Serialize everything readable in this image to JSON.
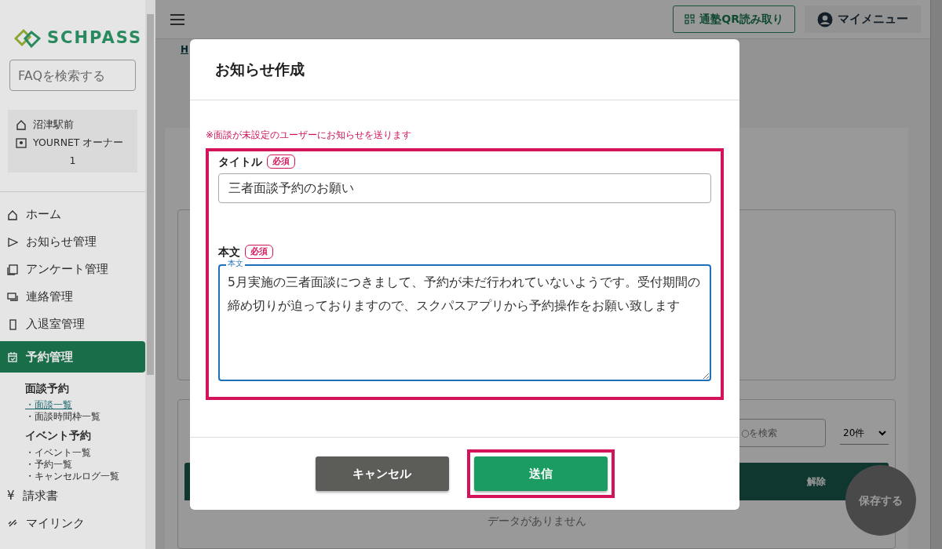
{
  "sidebar": {
    "logo": "SCHPASS",
    "faq_search": {
      "placeholder": "FAQを検索する"
    },
    "school": "沼津駅前",
    "user": "YOURNET オーナー",
    "user_number": "1",
    "items": [
      {
        "label": "ホーム",
        "kind": "home",
        "selected": false
      },
      {
        "label": "お知らせ管理",
        "kind": "send",
        "selected": false
      },
      {
        "label": "アンケート管理",
        "kind": "survey",
        "selected": false
      },
      {
        "label": "連絡管理",
        "kind": "chat",
        "selected": false
      },
      {
        "label": "入退室管理",
        "kind": "door",
        "selected": false
      },
      {
        "label": "予約管理",
        "kind": "calendar",
        "selected": true,
        "children": [
          {
            "title": "面談予約",
            "links": [
              {
                "label": "・面談一覧",
                "selected": true
              },
              {
                "label": "・面談時間枠一覧",
                "selected": false
              }
            ]
          },
          {
            "title": "イベント予約",
            "links": [
              {
                "label": "・イベント一覧",
                "selected": false
              },
              {
                "label": "・予約一覧",
                "selected": false
              },
              {
                "label": "・キャンセルログ一覧",
                "selected": false
              }
            ]
          }
        ]
      },
      {
        "label": "請求書",
        "kind": "text_icon",
        "icon": "¥",
        "selected": false
      },
      {
        "label": "マイリンク",
        "kind": "link",
        "selected": false
      }
    ]
  },
  "topbar": {
    "qr_button": "通塾QR読み取り",
    "my_menu": "マイメニュー"
  },
  "background": {
    "breadcrumb": "H",
    "search": {
      "placeholder": "○を検索"
    },
    "page_size": "20件",
    "column_header": "解除",
    "empty_text": "データがありません",
    "save_button": "保存する"
  },
  "modal": {
    "title": "お知らせ作成",
    "note": "※面談が未設定のユーザーにお知らせを送ります",
    "fields": [
      {
        "kind": "input",
        "label": "タイトル",
        "badge": "必須",
        "value": "三者面談予約のお願い"
      },
      {
        "kind": "textarea",
        "label": "本文",
        "badge": "必須",
        "floating_label": "本文",
        "value": "5月実施の三者面談につきまして、予約が未だ行われていないようです。受付期間の締め切りが迫っておりますので、スクパスアプリから予約操作をお願い致します"
      }
    ],
    "buttons": [
      {
        "label": "キャンセル",
        "kind": "cancel",
        "highlighted": false
      },
      {
        "label": "送信",
        "kind": "submit",
        "highlighted": true
      }
    ]
  }
}
